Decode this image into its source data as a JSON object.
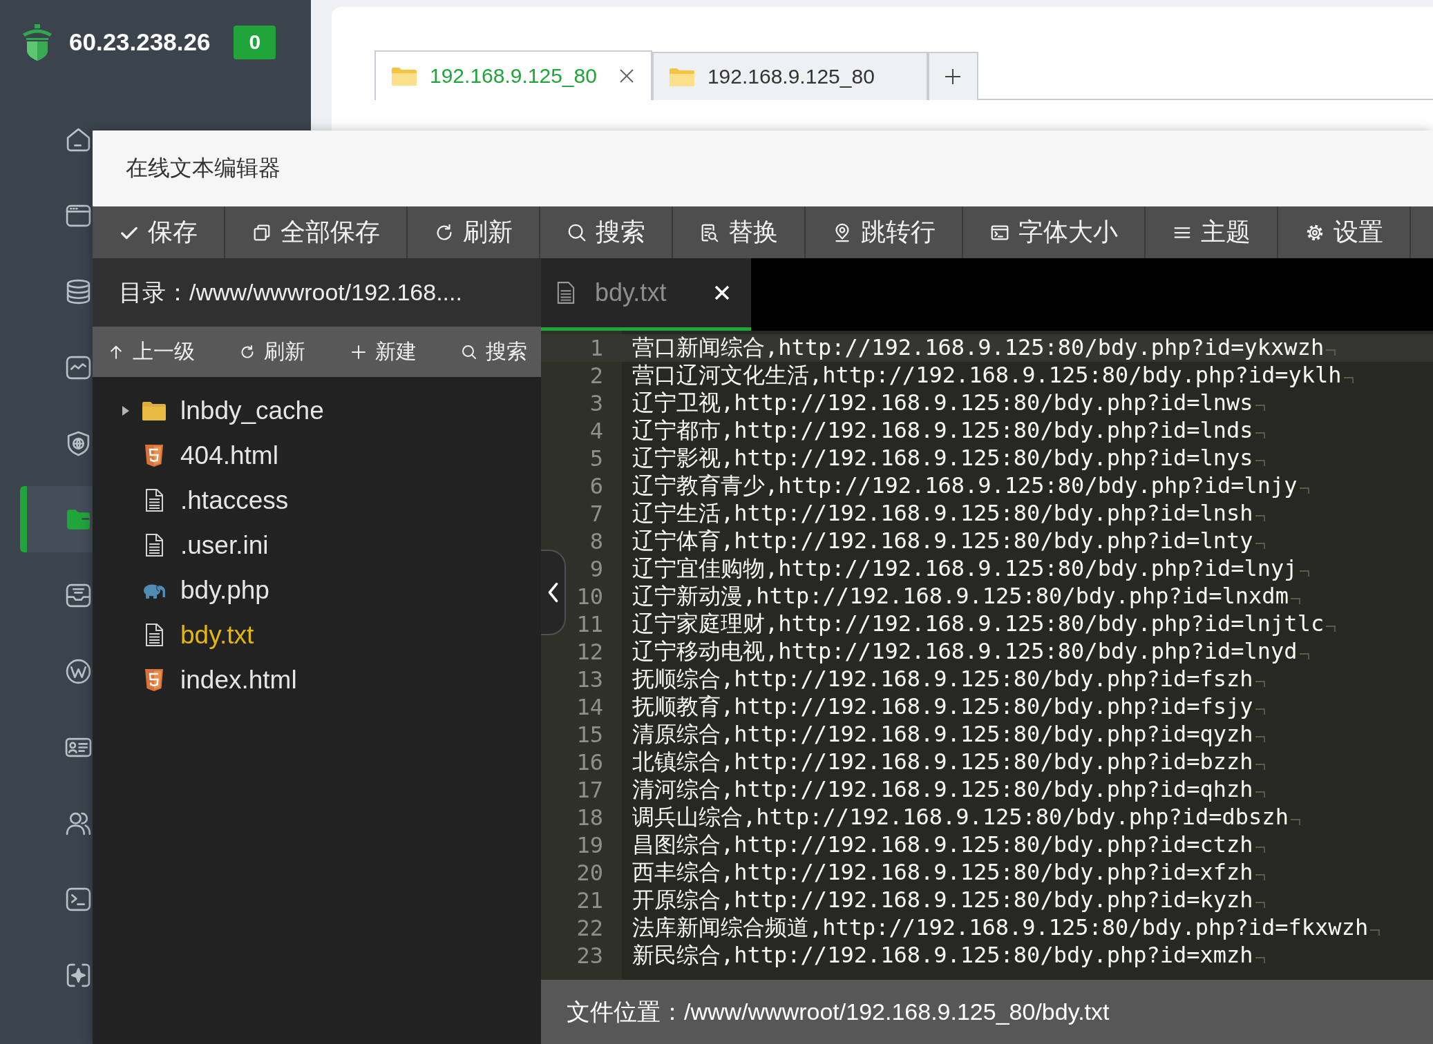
{
  "sidebar": {
    "host": "60.23.238.26",
    "badge": "0",
    "items": [
      {
        "selected": false
      },
      {
        "selected": false
      },
      {
        "selected": false
      },
      {
        "selected": false
      },
      {
        "selected": false
      },
      {
        "selected": true
      },
      {
        "selected": false
      },
      {
        "selected": false
      },
      {
        "selected": false
      },
      {
        "selected": false
      },
      {
        "selected": false
      },
      {
        "selected": false
      }
    ]
  },
  "browser_tabs": [
    {
      "label": "192.168.9.125_80",
      "selected": true
    },
    {
      "label": "192.168.9.125_80",
      "selected": false
    }
  ],
  "editor": {
    "title": "在线文本编辑器",
    "toolbar": [
      "保存",
      "全部保存",
      "刷新",
      "搜索",
      "替换",
      "跳转行",
      "字体大小",
      "主题",
      "设置"
    ],
    "directory": "目录：/www/wwwroot/192.168....",
    "file_toolbar": [
      "上一级",
      "刷新",
      "新建",
      "搜索"
    ],
    "files": [
      {
        "name": "lnbdy_cache",
        "kind": "folder",
        "expanded": false,
        "selected": false
      },
      {
        "name": "404.html",
        "kind": "html",
        "selected": false
      },
      {
        "name": ".htaccess",
        "kind": "text",
        "selected": false
      },
      {
        "name": ".user.ini",
        "kind": "text",
        "selected": false
      },
      {
        "name": "bdy.php",
        "kind": "php",
        "selected": false
      },
      {
        "name": "bdy.txt",
        "kind": "text",
        "selected": true
      },
      {
        "name": "index.html",
        "kind": "html",
        "selected": false
      }
    ],
    "tabs": [
      {
        "title": "bdy.txt",
        "selected": true
      }
    ],
    "show_invisibles": true,
    "lines": [
      {
        "number": "1",
        "text": "营口新闻综合,http://192.168.9.125:80/bdy.php?id=ykxwzh",
        "active": true
      },
      {
        "number": "2",
        "text": "营口辽河文化生活,http://192.168.9.125:80/bdy.php?id=yklh",
        "active": false
      },
      {
        "number": "3",
        "text": "辽宁卫视,http://192.168.9.125:80/bdy.php?id=lnws",
        "active": false
      },
      {
        "number": "4",
        "text": "辽宁都市,http://192.168.9.125:80/bdy.php?id=lnds",
        "active": false
      },
      {
        "number": "5",
        "text": "辽宁影视,http://192.168.9.125:80/bdy.php?id=lnys",
        "active": false
      },
      {
        "number": "6",
        "text": "辽宁教育青少,http://192.168.9.125:80/bdy.php?id=lnjy",
        "active": false
      },
      {
        "number": "7",
        "text": "辽宁生活,http://192.168.9.125:80/bdy.php?id=lnsh",
        "active": false
      },
      {
        "number": "8",
        "text": "辽宁体育,http://192.168.9.125:80/bdy.php?id=lnty",
        "active": false
      },
      {
        "number": "9",
        "text": "辽宁宜佳购物,http://192.168.9.125:80/bdy.php?id=lnyj",
        "active": false
      },
      {
        "number": "10",
        "text": "辽宁新动漫,http://192.168.9.125:80/bdy.php?id=lnxdm",
        "active": false
      },
      {
        "number": "11",
        "text": "辽宁家庭理财,http://192.168.9.125:80/bdy.php?id=lnjtlc",
        "active": false
      },
      {
        "number": "12",
        "text": "辽宁移动电视,http://192.168.9.125:80/bdy.php?id=lnyd",
        "active": false
      },
      {
        "number": "13",
        "text": "抚顺综合,http://192.168.9.125:80/bdy.php?id=fszh",
        "active": false
      },
      {
        "number": "14",
        "text": "抚顺教育,http://192.168.9.125:80/bdy.php?id=fsjy",
        "active": false
      },
      {
        "number": "15",
        "text": "清原综合,http://192.168.9.125:80/bdy.php?id=qyzh",
        "active": false
      },
      {
        "number": "16",
        "text": "北镇综合,http://192.168.9.125:80/bdy.php?id=bzzh",
        "active": false
      },
      {
        "number": "17",
        "text": "清河综合,http://192.168.9.125:80/bdy.php?id=qhzh",
        "active": false
      },
      {
        "number": "18",
        "text": "调兵山综合,http://192.168.9.125:80/bdy.php?id=dbszh",
        "active": false
      },
      {
        "number": "19",
        "text": "昌图综合,http://192.168.9.125:80/bdy.php?id=ctzh",
        "active": false
      },
      {
        "number": "20",
        "text": "西丰综合,http://192.168.9.125:80/bdy.php?id=xfzh",
        "active": false
      },
      {
        "number": "21",
        "text": "开原综合,http://192.168.9.125:80/bdy.php?id=kyzh",
        "active": false
      },
      {
        "number": "22",
        "text": "法库新闻综合频道,http://192.168.9.125:80/bdy.php?id=fkxwzh",
        "active": false
      },
      {
        "number": "23",
        "text": "新民综合,http://192.168.9.125:80/bdy.php?id=xmzh",
        "active": false
      }
    ],
    "status": "文件位置：/www/wwwroot/192.168.9.125_80/bdy.txt"
  }
}
